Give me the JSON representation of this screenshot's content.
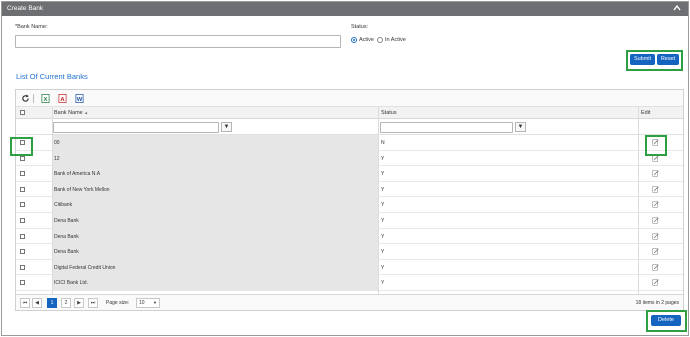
{
  "panel": {
    "title": "Create Bank"
  },
  "form": {
    "bank_name_label": "*Bank Name:",
    "bank_name_value": "",
    "status_label": "Status:",
    "status_options": [
      "Active",
      "In Active"
    ],
    "status_selected": "Active",
    "submit_label": "Submit",
    "reset_label": "Reset"
  },
  "list": {
    "title": "List Of Current Banks",
    "columns": {
      "name": "Bank Name",
      "status": "Status",
      "edit": "Edit"
    },
    "sort_indicator": "▲",
    "rows": [
      {
        "name": "00",
        "status": "N"
      },
      {
        "name": "12",
        "status": "Y"
      },
      {
        "name": "Bank of America N.A",
        "status": "Y"
      },
      {
        "name": "Bank of New York Mellon",
        "status": "Y"
      },
      {
        "name": "Citibank",
        "status": "Y"
      },
      {
        "name": "Dena Bank",
        "status": "Y"
      },
      {
        "name": "Dena Bank",
        "status": "Y"
      },
      {
        "name": "Dena Bank",
        "status": "Y"
      },
      {
        "name": "Digital Federal Credit Union",
        "status": "Y"
      },
      {
        "name": "ICICI Bank Ltd.",
        "status": "Y"
      }
    ],
    "pager": {
      "first": "⏮",
      "prev": "◀",
      "pages": [
        "1",
        "2"
      ],
      "current_page": "1",
      "next": "▶",
      "last": "⏭",
      "page_size_label": "Page size:",
      "page_size": "10",
      "summary": "18 items in 2 pages"
    },
    "filter_icon": "▼",
    "delete_label": "Delete"
  },
  "icons": [
    "refresh-icon",
    "excel-icon",
    "pdf-icon",
    "word-icon",
    "edit-icon",
    "chevron-up-icon",
    "filter-icon"
  ],
  "colors": {
    "header_bg": "#6d6f73",
    "accent": "#1565c0",
    "link": "#1f6fcf",
    "highlight": "#2ea043"
  }
}
